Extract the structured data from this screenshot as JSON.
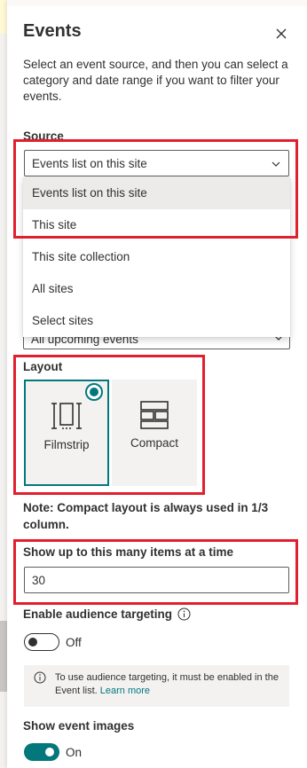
{
  "pane": {
    "title": "Events",
    "description": "Select an event source, and then you can select a category and date range if you want to filter your events."
  },
  "source": {
    "label": "Source",
    "selected_value": "Events list on this site",
    "options": [
      "Events list on this site",
      "This site",
      "This site collection",
      "All sites",
      "Select sites"
    ],
    "highlighted_option": "Events list on this site"
  },
  "date_range": {
    "partial_value": "All upcoming events"
  },
  "layout": {
    "label": "Layout",
    "options": [
      "Filmstrip",
      "Compact"
    ],
    "selected": "Filmstrip",
    "note": "Note: Compact layout is always used in 1/3 column."
  },
  "items_count": {
    "label": "Show up to this many items at a time",
    "value": "30"
  },
  "audience_targeting": {
    "label": "Enable audience targeting",
    "toggle_text": "Off",
    "enabled": false,
    "message": "To use audience targeting, it must be enabled in the Event list.",
    "link_text": "Learn more"
  },
  "event_images": {
    "label": "Show event images",
    "toggle_text": "On",
    "enabled": true
  },
  "colors": {
    "accent": "#03787c",
    "highlight_border": "#e0202e",
    "text": "#323130"
  },
  "icons": [
    "close-icon",
    "chevron-down-icon",
    "filmstrip-icon",
    "compact-icon",
    "info-icon"
  ]
}
